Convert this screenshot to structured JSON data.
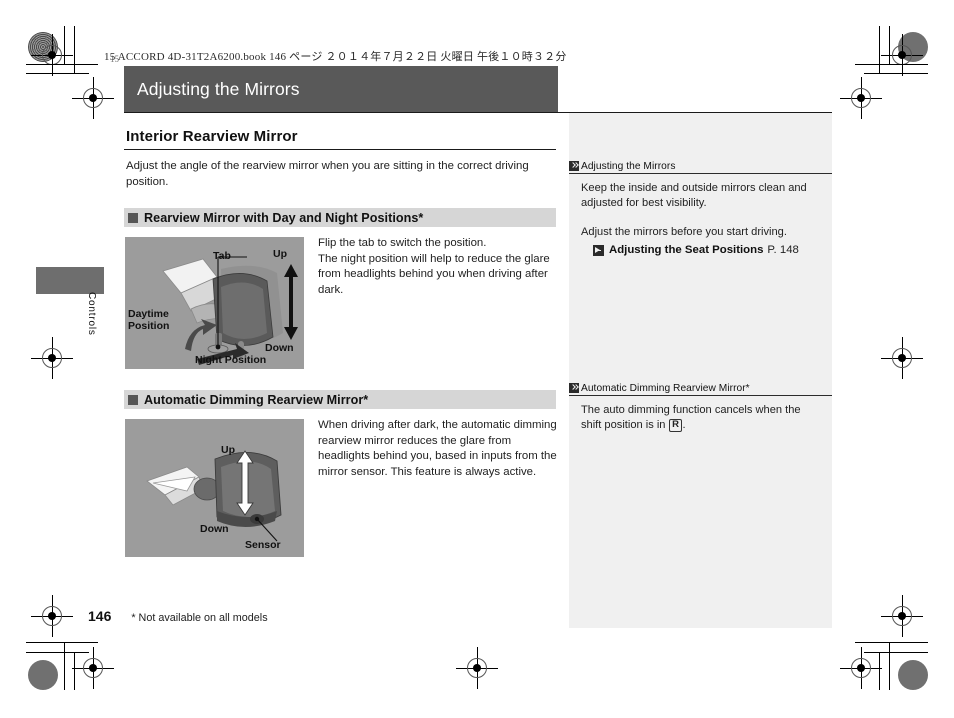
{
  "print_header": "15 ACCORD 4D-31T2A6200.book   146 ページ   ２０１４年７月２２日   火曜日   午後１０時３２分",
  "corner_mark_number": "15",
  "chapter": {
    "title": "Adjusting the Mirrors",
    "edge_tab_label": "Controls"
  },
  "main": {
    "subheading": "Interior Rearview Mirror",
    "intro": "Adjust the angle of the rearview mirror when you are sitting in the correct driving position.",
    "sections": [
      {
        "heading": "Rearview Mirror with Day and Night Positions*",
        "body": "Flip the tab to switch the position.\nThe night position will help to reduce the glare from headlights behind you when driving after dark.",
        "figure_labels": {
          "tab": "Tab",
          "up": "Up",
          "down": "Down",
          "daytime": "Daytime\nPosition",
          "night": "Night Position"
        }
      },
      {
        "heading": "Automatic Dimming Rearview Mirror*",
        "body": "When driving after dark, the automatic dimming rearview mirror reduces the glare from headlights behind you, based in inputs from the mirror sensor. This feature is always active.",
        "figure_labels": {
          "up": "Up",
          "down": "Down",
          "sensor": "Sensor"
        }
      }
    ]
  },
  "sidebar": {
    "blocks": [
      {
        "title": "Adjusting the Mirrors",
        "paragraphs": [
          "Keep the inside and outside mirrors clean and adjusted for best visibility.",
          "Adjust the mirrors before you start driving."
        ],
        "reference": {
          "title": "Adjusting the Seat Positions",
          "page": "P. 148"
        }
      },
      {
        "title": "Automatic Dimming Rearview Mirror*",
        "paragraph_before": "The auto dimming function cancels when the shift position is in",
        "gear": "R",
        "paragraph_after": "."
      }
    ]
  },
  "footer": {
    "page_number": "146",
    "footnote": "* Not available on all models"
  },
  "colors": {
    "title_bar": "#595959",
    "section_band": "#d6d6d6",
    "figure_bg": "#9c9c9c",
    "sidebar_bg": "#f0f0f0",
    "edge_tab": "#6e6e6e"
  }
}
